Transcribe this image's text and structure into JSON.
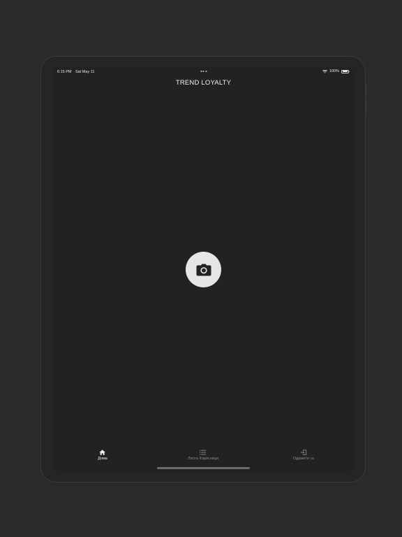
{
  "status_bar": {
    "time": "6:15 PM",
    "date": "Sat May 11",
    "battery": "100%",
    "wifi_icon": "wifi-icon",
    "battery_icon": "battery-icon"
  },
  "nav": {
    "title": "TREND LOYALTY"
  },
  "main": {
    "camera_icon": "camera-icon"
  },
  "tabs": [
    {
      "label": "Дома",
      "icon": "house-icon",
      "active": true
    },
    {
      "label": "Листа Корисници",
      "icon": "list-icon",
      "active": false
    },
    {
      "label": "Одјавете се",
      "icon": "logout-icon",
      "active": false
    }
  ],
  "colors": {
    "background": "#2a2a2a",
    "screen": "#222222",
    "camera_button": "#e6e6e6",
    "tab_active": "#f2f2f2",
    "tab_inactive": "#8a8a8a"
  }
}
